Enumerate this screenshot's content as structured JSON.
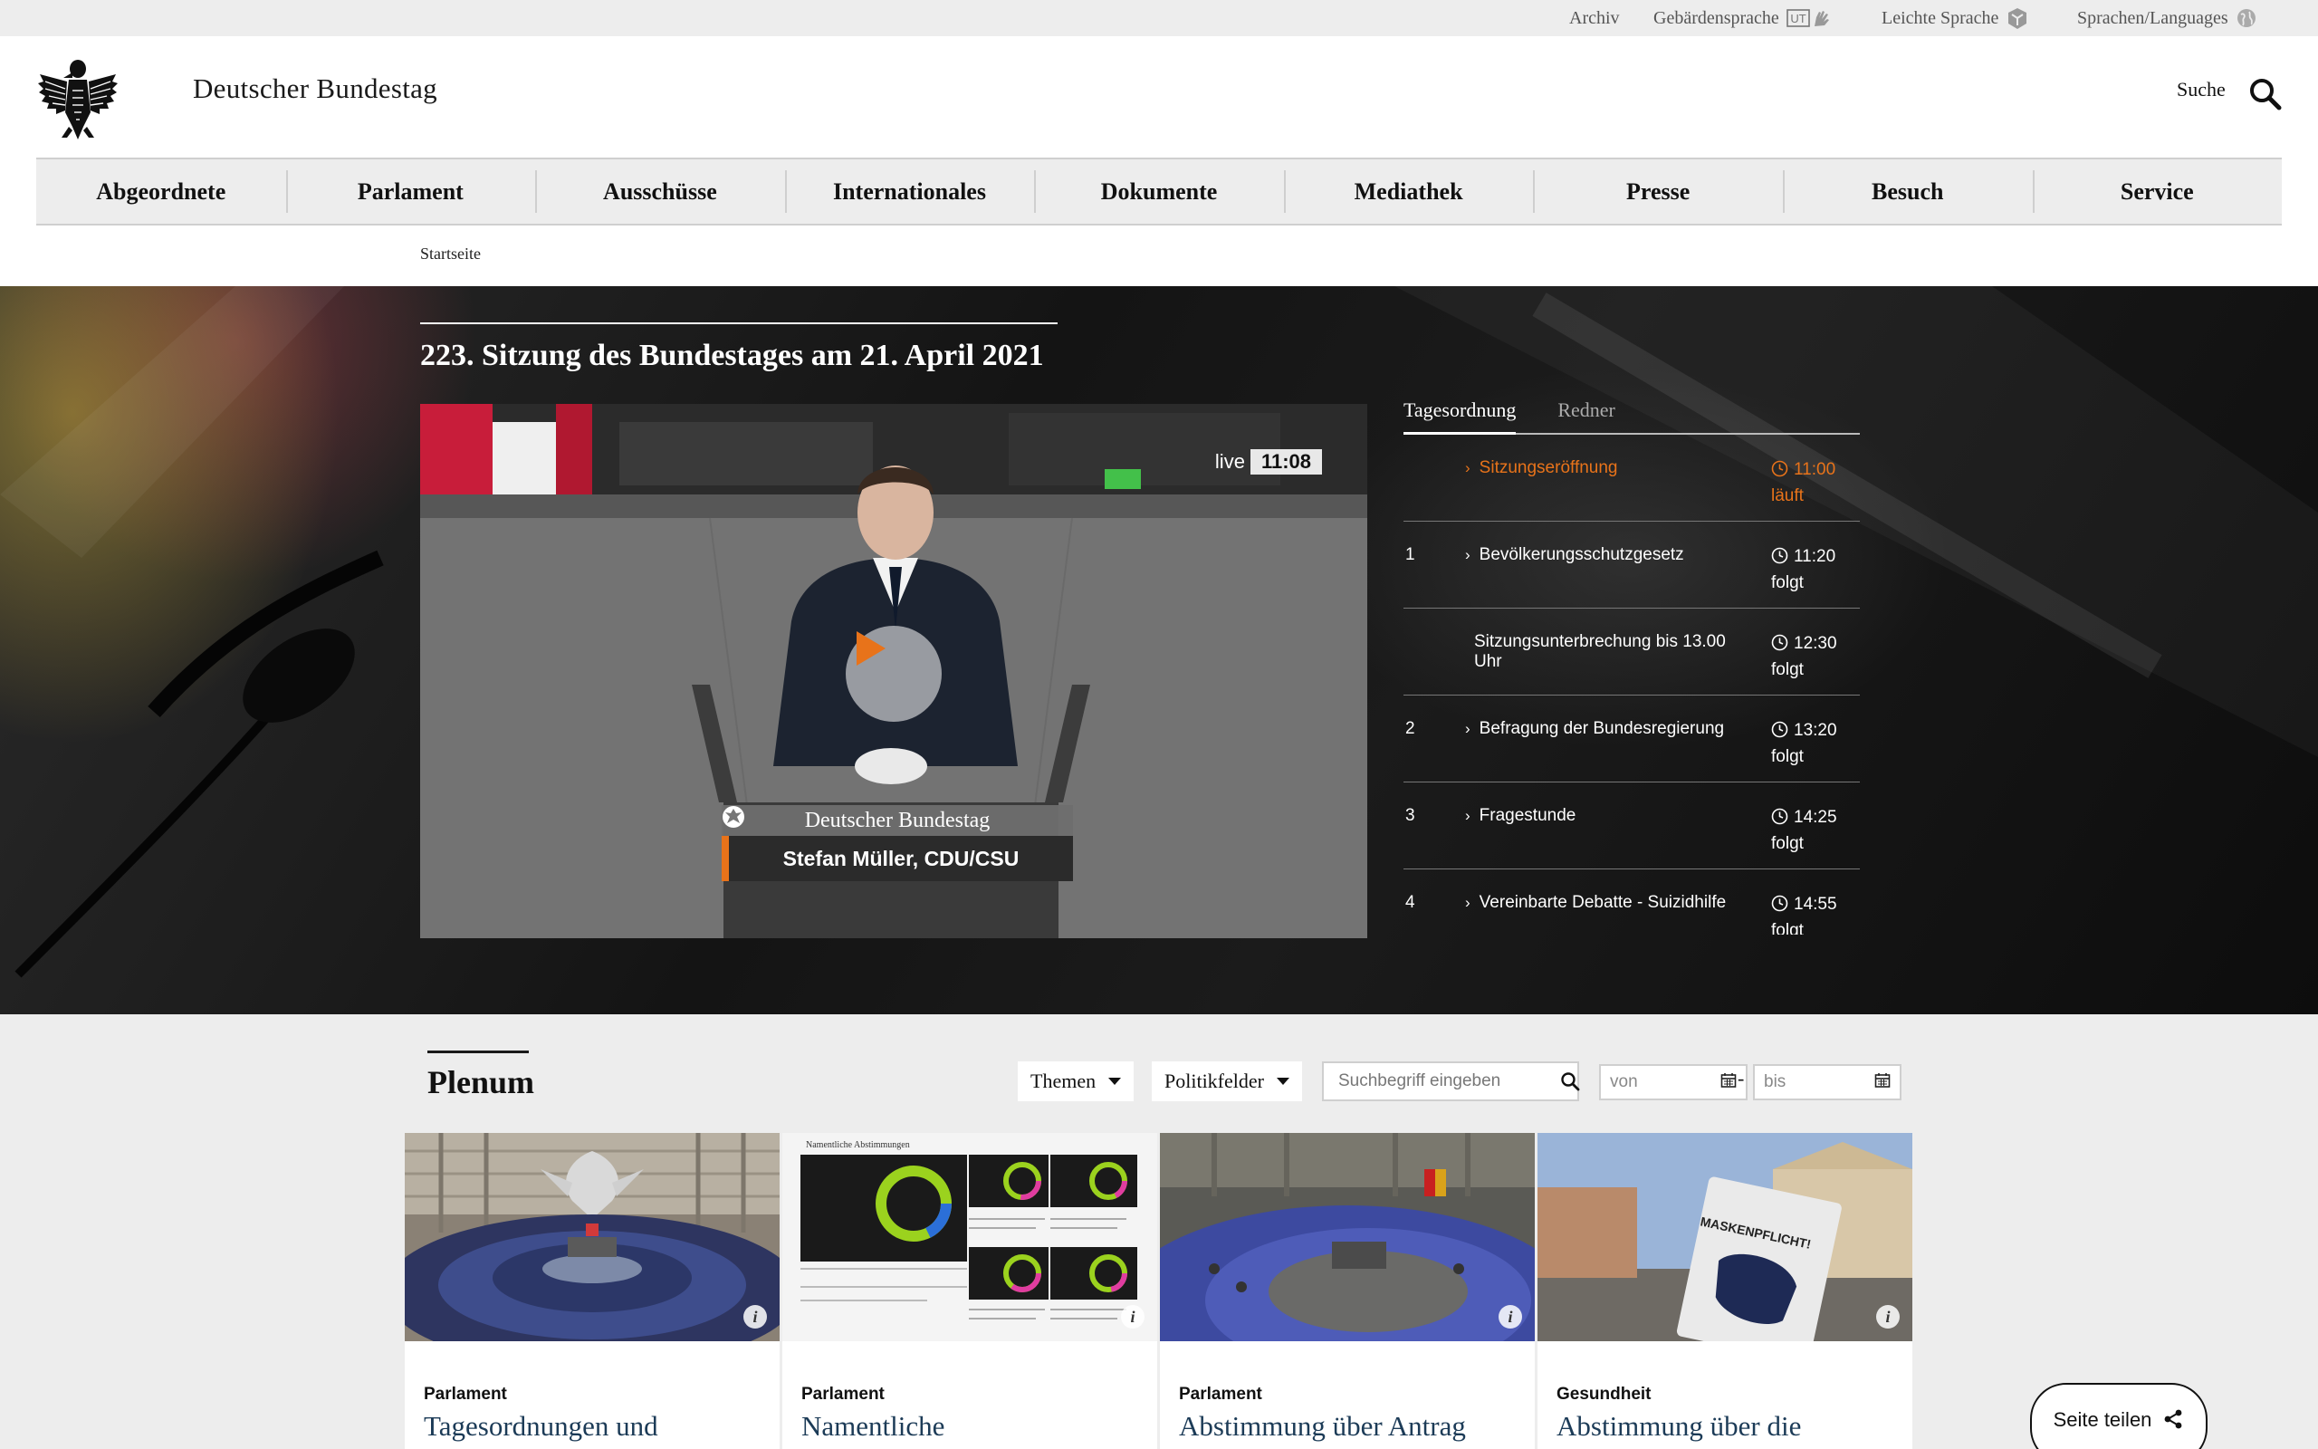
{
  "utility_nav": {
    "archive": "Archiv",
    "sign_language": "Gebärdensprache",
    "sign_language_badge": "UT",
    "easy_language": "Leichte Sprache",
    "languages": "Sprachen/Languages"
  },
  "header": {
    "site_title": "Deutscher Bundestag",
    "search_label": "Suche"
  },
  "main_nav": {
    "items": [
      "Abgeordnete",
      "Parlament",
      "Ausschüsse",
      "Internationales",
      "Dokumente",
      "Mediathek",
      "Presse",
      "Besuch",
      "Service"
    ]
  },
  "breadcrumb": "Startseite",
  "hero": {
    "title": "223. Sitzung des Bundestages am 21. April 2021",
    "player": {
      "live_label": "live",
      "live_time": "11:08",
      "lower_third_org": "Deutscher Bundestag",
      "lower_third_name": "Stefan Müller, CDU/CSU"
    },
    "agenda_tabs": [
      "Tagesordnung",
      "Redner"
    ],
    "agenda": [
      {
        "num": "",
        "title": "Sitzungseröffnung",
        "time": "11:00",
        "status": "läuft",
        "chevron": "›"
      },
      {
        "num": "1",
        "title": "Bevölkerungsschutzgesetz",
        "time": "11:20",
        "status": "folgt",
        "chevron": "›"
      },
      {
        "num": "",
        "title": "Sitzungsunterbrechung bis 13.00 Uhr",
        "time": "12:30",
        "status": "folgt",
        "chevron": ""
      },
      {
        "num": "2",
        "title": "Befragung der Bundesregierung",
        "time": "13:20",
        "status": "folgt",
        "chevron": "›"
      },
      {
        "num": "3",
        "title": "Fragestunde",
        "time": "14:25",
        "status": "folgt",
        "chevron": "›"
      },
      {
        "num": "4",
        "title": "Vereinbarte Debatte - Suizidhilfe",
        "time": "14:55",
        "status": "folgt",
        "chevron": "›"
      }
    ]
  },
  "plenum": {
    "title": "Plenum",
    "filters": {
      "themen": "Themen",
      "politikfelder": "Politikfelder",
      "search_placeholder": "Suchbegriff eingeben",
      "date_from_placeholder": "von",
      "date_separator": "-",
      "date_to_placeholder": "bis"
    },
    "cards": [
      {
        "category": "Parlament",
        "title": "Tagesordnungen und"
      },
      {
        "category": "Parlament",
        "title": "Namentliche"
      },
      {
        "category": "Parlament",
        "title": "Abstimmung über Antrag"
      },
      {
        "category": "Gesundheit",
        "title": "Abstimmung über die"
      }
    ],
    "card2_thumb": {
      "heading": "Namentliche Abstimmungen"
    },
    "card4_thumb": {
      "sign_text": "MASKENPFLICHT!"
    }
  },
  "share": {
    "label": "Seite teilen"
  },
  "colors": {
    "accent_orange": "#e8731a",
    "title_blue": "#1c3b57",
    "bar_gray": "#ededed"
  },
  "icons": [
    "eagle-logo-icon",
    "search-icon",
    "sign-language-icon",
    "easy-language-icon",
    "globe-icon",
    "play-icon",
    "clock-icon",
    "chevron-right-icon",
    "calendar-icon",
    "info-icon",
    "share-icon"
  ]
}
